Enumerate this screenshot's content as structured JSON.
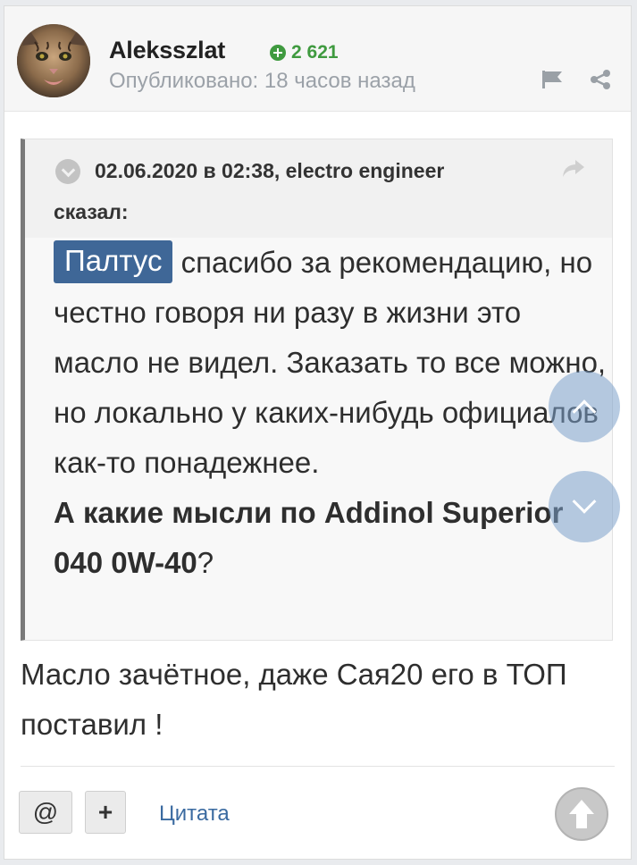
{
  "post": {
    "author": "Aleksszlat",
    "reputation": "2 621",
    "published": "Опубликовано: 18 часов назад"
  },
  "quote": {
    "citation_line1": "02.06.2020 в 02:38, electro engineer",
    "citation_line2": "сказал:",
    "mention": "Палтус",
    "text_after_mention": " спасибо за рекомендацию, но честно говоря ни разу в жизни это масло не видел. Заказать то все можно, но локально у каких-нибудь официалов как-то понадежнее.",
    "bold_question": "А какие мысли по Addinol Superior 040 0W-40",
    "question_mark": "?"
  },
  "reply": {
    "text": "Масло зачётное, даже Cая20 его в ТОП поставил !"
  },
  "footer": {
    "mention_button": "@",
    "add_button": "+",
    "quote_link": "Цитата"
  },
  "colors": {
    "reputation_green": "#3f9a3f",
    "mention_blue": "#3f6797",
    "link_blue": "#3a6aa0",
    "scroll_button": "#7ca0ca"
  }
}
